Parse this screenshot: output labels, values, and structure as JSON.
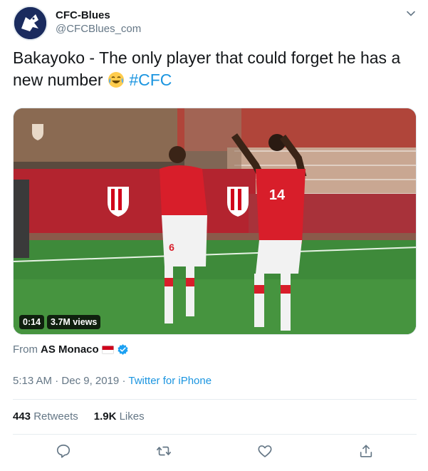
{
  "tweet": {
    "author": {
      "display_name": "CFC-Blues",
      "handle": "@CFCBlues_com",
      "avatar_icon": "chelsea-lion-icon"
    },
    "text": {
      "body": "Bakayoko - The only player that could forget he has a new number",
      "emoji": "face-with-tears-of-joy",
      "hashtag": "#CFC"
    },
    "media": {
      "duration": "0:14",
      "views": "3.7M views",
      "player_numbers": [
        "6",
        "14"
      ]
    },
    "attribution": {
      "prefix": "From",
      "source": "AS Monaco",
      "flag": "monaco-flag-icon",
      "verified": true
    },
    "meta": {
      "time": "5:13 AM",
      "separator": "·",
      "date": "Dec 9, 2019",
      "client": "Twitter for iPhone"
    },
    "stats": {
      "retweets_count": "443",
      "retweets_label": "Retweets",
      "likes_count": "1.9K",
      "likes_label": "Likes"
    },
    "actions": [
      "reply-icon",
      "retweet-icon",
      "like-icon",
      "share-icon"
    ],
    "colors": {
      "link": "#1b95e0",
      "secondary_text": "#657786",
      "primary_text": "#14171a",
      "monaco_red": "#d0021b"
    }
  }
}
